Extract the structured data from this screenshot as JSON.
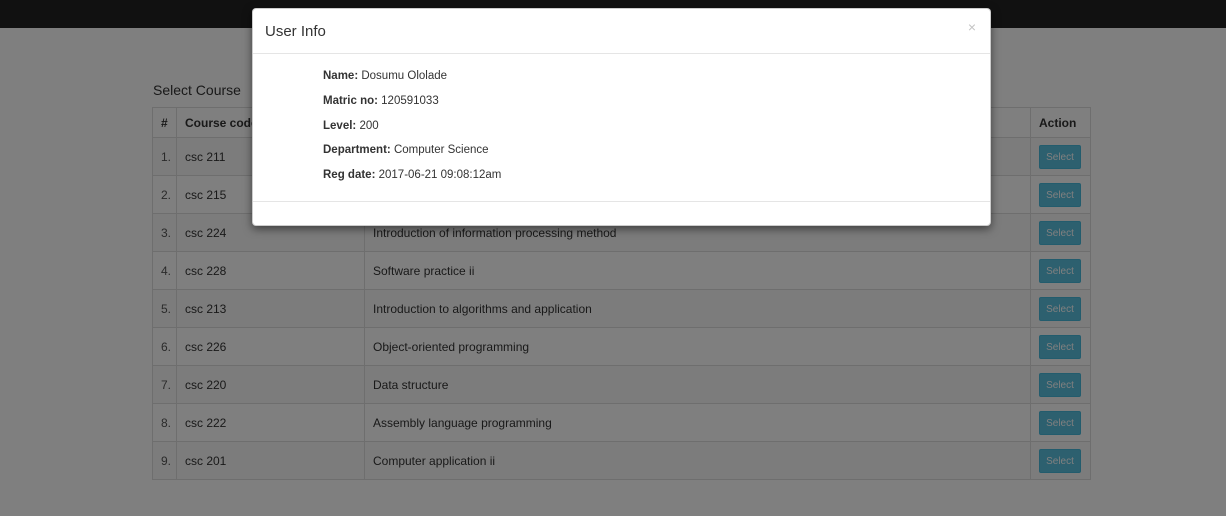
{
  "page": {
    "section_title": "Select Course"
  },
  "table": {
    "headers": {
      "num": "#",
      "code": "Course code",
      "title": "",
      "action": "Action"
    },
    "rows": [
      {
        "num": "1.",
        "code": "csc 211",
        "title": "",
        "action": "Select"
      },
      {
        "num": "2.",
        "code": "csc 215",
        "title": "",
        "action": "Select"
      },
      {
        "num": "3.",
        "code": "csc 224",
        "title": "Introduction of information processing method",
        "action": "Select"
      },
      {
        "num": "4.",
        "code": "csc 228",
        "title": "Software practice ii",
        "action": "Select"
      },
      {
        "num": "5.",
        "code": "csc 213",
        "title": "Introduction to algorithms and application",
        "action": "Select"
      },
      {
        "num": "6.",
        "code": "csc 226",
        "title": "Object-oriented programming",
        "action": "Select"
      },
      {
        "num": "7.",
        "code": "csc 220",
        "title": "Data structure",
        "action": "Select"
      },
      {
        "num": "8.",
        "code": "csc 222",
        "title": "Assembly language programming",
        "action": "Select"
      },
      {
        "num": "9.",
        "code": "csc 201",
        "title": "Computer application ii",
        "action": "Select"
      }
    ]
  },
  "modal": {
    "title": "User Info",
    "close": "×",
    "fields": {
      "name_label": "Name:",
      "name_value": "Dosumu Ololade",
      "matric_label": "Matric no:",
      "matric_value": "120591033",
      "level_label": "Level:",
      "level_value": "200",
      "dept_label": "Department:",
      "dept_value": "Computer Science",
      "reg_label": "Reg date:",
      "reg_value": "2017-06-21 09:08:12am"
    }
  },
  "colors": {
    "navbar": "#222222",
    "select_button": "#5bc0de",
    "backdrop": "rgba(0,0,0,0.5)"
  }
}
